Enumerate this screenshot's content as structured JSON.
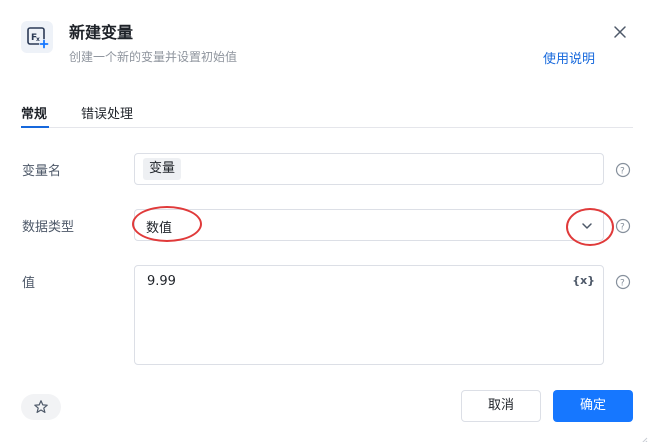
{
  "header": {
    "title": "新建变量",
    "subtitle": "创建一个新的变量并设置初始值",
    "help_link": "使用说明",
    "icon": "variable-function-icon"
  },
  "tabs": [
    {
      "label": "常规",
      "active": true
    },
    {
      "label": "错误处理",
      "active": false
    }
  ],
  "form": {
    "variable_name": {
      "label": "变量名",
      "value": "变量"
    },
    "data_type": {
      "label": "数据类型",
      "value": "数值"
    },
    "value": {
      "label": "值",
      "value": "9.99",
      "insert_variable": "{x}"
    }
  },
  "footer": {
    "cancel_label": "取消",
    "confirm_label": "确定"
  },
  "colors": {
    "accent": "#1677ff",
    "link": "#1668dc",
    "annotation": "#e03a3a"
  }
}
